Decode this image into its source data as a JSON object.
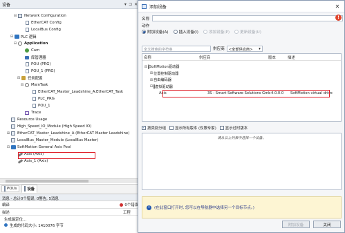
{
  "left_panel": {
    "title": "设备",
    "controls": [
      "▾",
      "⊐",
      "✕"
    ],
    "tree": [
      {
        "label": "Network Configuration",
        "icon": "network-icon",
        "depth": 3,
        "exp": "⊟"
      },
      {
        "label": "EtherCAT Config",
        "icon": "doc-icon",
        "depth": 5,
        "exp": ""
      },
      {
        "label": "LocalBus Config",
        "icon": "doc-icon",
        "depth": 5,
        "exp": ""
      },
      {
        "label": "PLC 逻辑",
        "icon": "plc-icon",
        "depth": 2,
        "exp": "⊟"
      },
      {
        "label": "Application",
        "icon": "gear-icon",
        "depth": 3,
        "exp": "⊟",
        "bold": true
      },
      {
        "label": "Cam",
        "icon": "cam-icon",
        "depth": 5,
        "exp": ""
      },
      {
        "label": "库管理器",
        "icon": "library-icon",
        "depth": 5,
        "exp": ""
      },
      {
        "label": "POU (PRG)",
        "icon": "doc-icon",
        "depth": 5,
        "exp": ""
      },
      {
        "label": "POU_1 (PRG)",
        "icon": "doc-icon",
        "depth": 5,
        "exp": ""
      },
      {
        "label": "任务配置",
        "icon": "task-icon",
        "depth": 4,
        "exp": "⊟"
      },
      {
        "label": "MainTask",
        "icon": "gear-icon",
        "depth": 5,
        "exp": "⊟"
      },
      {
        "label": "EtherCAT_Master_Leadshine_A.EtherCAT_Task",
        "icon": "doc-icon",
        "depth": 7,
        "exp": ""
      },
      {
        "label": "PLC_PRG",
        "icon": "doc-icon",
        "depth": 7,
        "exp": ""
      },
      {
        "label": "POU_1",
        "icon": "doc-icon",
        "depth": 7,
        "exp": ""
      },
      {
        "label": "Trace",
        "icon": "trace-icon",
        "depth": 5,
        "exp": ""
      },
      {
        "label": "Resource Usage",
        "icon": "square-icon",
        "depth": 1,
        "exp": ""
      },
      {
        "label": "High_Speed_IO_Module (High Speed IO)",
        "icon": "square-icon",
        "depth": 1,
        "exp": ""
      },
      {
        "label": "EtherCAT_Master_Leadshine_A (EtherCAT Master Leadshine)",
        "icon": "square-icon",
        "depth": 1,
        "exp": "⊞"
      },
      {
        "label": "LocalBus_Master_Module (LocalBus Master)",
        "icon": "square-icon",
        "depth": 1,
        "exp": ""
      },
      {
        "label": "SoftMotion General Axis Pool",
        "icon": "axis-pool-icon",
        "depth": 1,
        "exp": "⊟"
      },
      {
        "label": "Axis (Axis)",
        "icon": "axis-icon",
        "depth": 3,
        "exp": ""
      },
      {
        "label": "Axis_1 (Axis)",
        "icon": "axis-icon",
        "depth": 3,
        "exp": ""
      }
    ],
    "tabs": [
      {
        "label": "POUs",
        "icon": "pou-icon"
      },
      {
        "label": "设备",
        "icon": "device-icon"
      }
    ]
  },
  "messages": {
    "title": "消息 - 总计0个错误, 0警告, 5消息",
    "filter": "编译",
    "errors_label": "0个错误",
    "col_desc": "描述",
    "col_project": "工程",
    "rows": [
      "生成最定位...",
      "生成的代码大小: 1410076 字节"
    ]
  },
  "dialog": {
    "title": "添加设备",
    "close": "✕",
    "name_label": "名称",
    "name_value": "",
    "error_mark": "!",
    "action_label": "动作",
    "actions": [
      {
        "label": "附加设备(A)",
        "on": true,
        "disabled": false
      },
      {
        "label": "插入设备(I)",
        "on": false,
        "disabled": false
      },
      {
        "label": "添加设备(P)",
        "on": false,
        "disabled": true
      },
      {
        "label": "更新设备(U)",
        "on": false,
        "disabled": true
      }
    ],
    "search_placeholder": "全文搜索的字符串",
    "vendor_label": "供应商",
    "vendor_value": "<全部供应商>",
    "columns": {
      "name": "名称",
      "vendor": "供应商",
      "version": "版本",
      "desc": "描述"
    },
    "rows": [
      {
        "depth": 0,
        "exp": "⊟",
        "icon": "softmotion-icon",
        "name": "SoftMotion驱动器",
        "vendor": "",
        "version": "",
        "desc": ""
      },
      {
        "depth": 1,
        "exp": "⊞",
        "icon": "position-icon",
        "name": "位置控制驱动器",
        "vendor": "",
        "version": "",
        "desc": ""
      },
      {
        "depth": 1,
        "exp": "⊞",
        "icon": "free-icon",
        "name": "自由编码器",
        "vendor": "",
        "version": "",
        "desc": ""
      },
      {
        "depth": 1,
        "exp": "⊟",
        "icon": "virtual-icon",
        "name": "虚拟驱动器",
        "vendor": "",
        "version": "",
        "desc": ""
      },
      {
        "depth": 2,
        "exp": "",
        "icon": "axis-icon",
        "name": "Axis",
        "vendor": "3S - Smart Software Solutions GmbH",
        "version": "4.0.0.0",
        "desc": "SoftMotion virtual drive",
        "selected": true
      }
    ],
    "checks": [
      {
        "label": "按类别分组",
        "checked": true
      },
      {
        "label": "显示所有版本 (仅限专家)",
        "checked": false
      },
      {
        "label": "显示过时版本",
        "checked": false
      }
    ],
    "info_hint": "请从以上列表中选择一个设备。",
    "tip_icon": "i",
    "tip_text": "(在此窗口打开时, 您可以在导航器中选择另一个目标节点。)",
    "buttons": [
      {
        "label": "附加设备",
        "disabled": true
      },
      {
        "label": "关闭",
        "disabled": false
      }
    ]
  }
}
